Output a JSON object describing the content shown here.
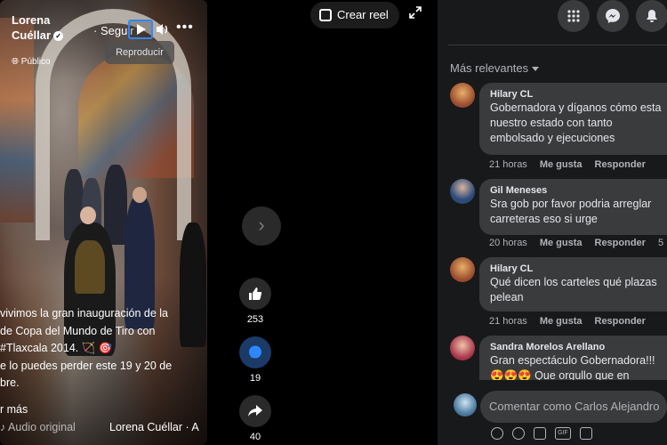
{
  "video": {
    "author": "Lorena Cuéllar",
    "author_line1": "Lorena",
    "author_line2": "Cuéllar",
    "audience": "Público",
    "follow_label": "· Seguir",
    "tooltip": "Reproducir",
    "caption_lines": [
      "vivimos la gran inauguración de la",
      "de Copa del Mundo de Tiro con",
      "#Tlaxcala 2014. 🏹 🎯",
      "e lo puedes perder este 19 y 20 de",
      "bre."
    ],
    "see_more": "r más",
    "audio_label": "Audio original",
    "audio_author": "Lorena Cuéllar · A"
  },
  "header": {
    "create_reel": "Crear reel"
  },
  "actions": {
    "likes": "253",
    "comments": "19",
    "shares": "40"
  },
  "comments_panel": {
    "sort_label": "Más relevantes",
    "comments": [
      {
        "author": "Hilary CL",
        "lines": [
          "Gobernadora y díganos cómo esta",
          "nuestro estado con tanto",
          "embolsado y ejecuciones"
        ],
        "time": "21 horas",
        "like": "Me gusta",
        "reply": "Responder"
      },
      {
        "author": "Gil Meneses",
        "lines": [
          "Sra gob por favor podria arreglar",
          "carreteras eso si urge"
        ],
        "time": "20 horas",
        "like": "Me gusta",
        "reply": "Responder",
        "extra": "5"
      },
      {
        "author": "Hilary CL",
        "lines": [
          "Qué dicen los carteles qué plazas",
          "pelean"
        ],
        "time": "21 horas",
        "like": "Me gusta",
        "reply": "Responder"
      },
      {
        "author": "Sandra Morelos Arellano",
        "lines": [
          "Gran espectáculo Gobernadora!!!",
          "😍😍😍 Que orgullo que en"
        ],
        "time": "",
        "like": "",
        "reply": ""
      }
    ],
    "input_placeholder": "Comentar como Carlos Alejandro"
  }
}
